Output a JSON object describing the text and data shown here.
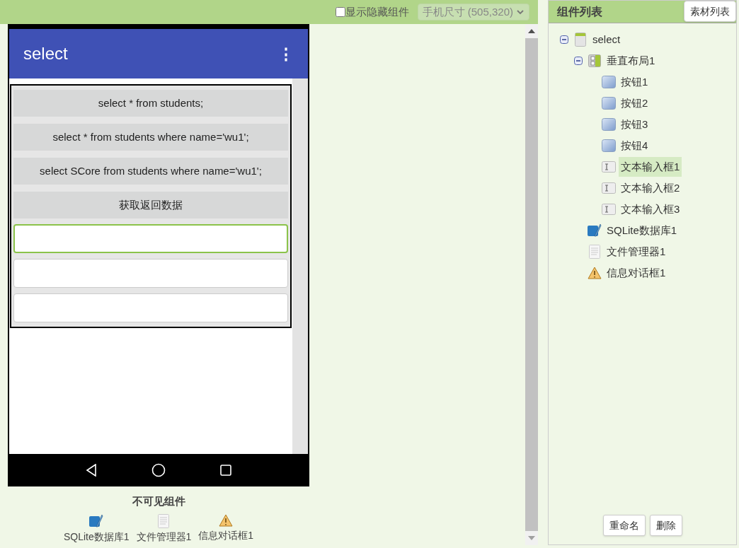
{
  "toolbar": {
    "show_hidden": {
      "label": "显示隐藏组件",
      "checked": false
    },
    "size_select": {
      "value": "手机尺寸 (505,320)"
    }
  },
  "phone": {
    "title": "select",
    "menu": "⋮",
    "components": [
      {
        "kind": "button",
        "text": "select * from students;"
      },
      {
        "kind": "button",
        "text": "select * from students where name='wu1';"
      },
      {
        "kind": "button",
        "text": "select SCore from students where name='wu1';"
      },
      {
        "kind": "button",
        "text": "获取返回数据"
      },
      {
        "kind": "textbox",
        "selected": true
      },
      {
        "kind": "textbox",
        "selected": false
      },
      {
        "kind": "textbox",
        "selected": false
      }
    ]
  },
  "nonvisible": {
    "title": "不可见组件",
    "items": [
      {
        "kind": "sqlite",
        "label": "SQLite数据库1"
      },
      {
        "kind": "file",
        "label": "文件管理器1"
      },
      {
        "kind": "notifier",
        "label": "信息对话框1"
      }
    ]
  },
  "components_panel": {
    "title": "组件列表",
    "assets_button": "素材列表",
    "tree": [
      {
        "kind": "form",
        "label": "select",
        "expanded": true,
        "selected": false,
        "children": [
          {
            "kind": "vertical",
            "label": "垂直布局1",
            "expanded": true,
            "selected": false,
            "children": [
              {
                "kind": "button",
                "label": "按钮1",
                "selected": false
              },
              {
                "kind": "button",
                "label": "按钮2",
                "selected": false
              },
              {
                "kind": "button",
                "label": "按钮3",
                "selected": false
              },
              {
                "kind": "button",
                "label": "按钮4",
                "selected": false
              },
              {
                "kind": "textbox",
                "label": "文本输入框1",
                "selected": true
              },
              {
                "kind": "textbox",
                "label": "文本输入框2",
                "selected": false
              },
              {
                "kind": "textbox",
                "label": "文本输入框3",
                "selected": false
              }
            ]
          },
          {
            "kind": "sqlite",
            "label": "SQLite数据库1",
            "selected": false
          },
          {
            "kind": "file",
            "label": "文件管理器1",
            "selected": false
          },
          {
            "kind": "notifier",
            "label": "信息对话框1",
            "selected": false
          }
        ]
      }
    ],
    "buttons": [
      "重命名",
      "删除"
    ]
  }
}
